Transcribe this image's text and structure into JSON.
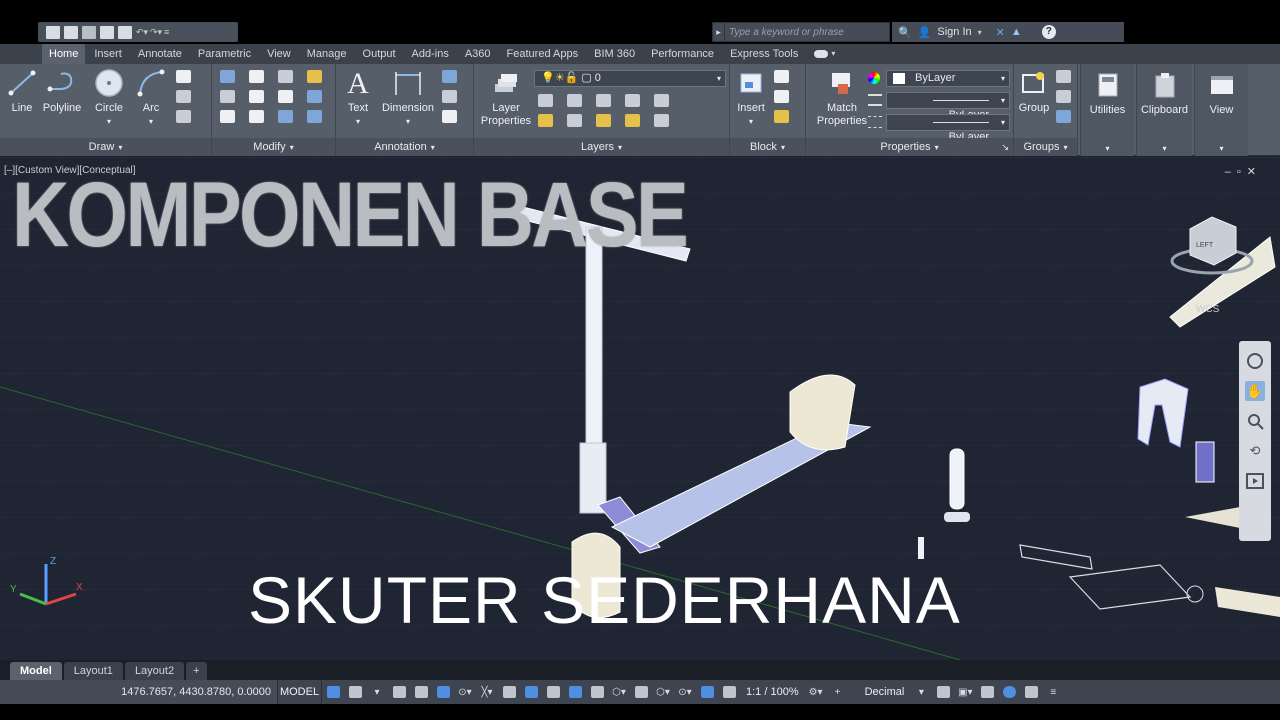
{
  "app": {
    "qat_icons": [
      "new-icon",
      "open-icon",
      "save-icon",
      "saveas-icon",
      "print-icon",
      "undo-icon",
      "redo-icon",
      "customize-icon"
    ],
    "search_placeholder": "Type a keyword or phrase",
    "sign_in": "Sign In",
    "help": "?"
  },
  "ribbon_tabs": [
    "Home",
    "Insert",
    "Annotate",
    "Parametric",
    "View",
    "Manage",
    "Output",
    "Add-ins",
    "A360",
    "Featured Apps",
    "BIM 360",
    "Performance",
    "Express Tools"
  ],
  "ribbon": {
    "draw": {
      "title": "Draw",
      "line": "Line",
      "polyline": "Polyline",
      "circle": "Circle",
      "arc": "Arc"
    },
    "modify": {
      "title": "Modify"
    },
    "annotation": {
      "title": "Annotation",
      "text": "Text",
      "dimension": "Dimension"
    },
    "layers": {
      "title": "Layers",
      "layer_properties_1": "Layer",
      "layer_properties_2": "Properties",
      "current_layer": "0"
    },
    "block": {
      "title": "Block",
      "insert": "Insert"
    },
    "properties": {
      "title": "Properties",
      "match_1": "Match",
      "match_2": "Properties",
      "color": "ByLayer",
      "linetype": "ByLayer",
      "lineweight": "ByLayer"
    },
    "groups": {
      "title": "Groups",
      "group": "Group"
    },
    "utilities": "Utilities",
    "clipboard": "Clipboard",
    "view": "View"
  },
  "viewport": {
    "label": "[–][Custom View][Conceptual]",
    "title_overlay": "KOMPONEN BASE",
    "subtitle_overlay": "SKUTER SEDERHANA",
    "viewcube_left": "LEFT",
    "viewcube_wcs": "WCS"
  },
  "layout_tabs": [
    "Model",
    "Layout1",
    "Layout2",
    "+"
  ],
  "status": {
    "coords": "1476.7657, 4430.8780, 0.0000",
    "model": "MODEL",
    "scale": "1:1 / 100%",
    "units": "Decimal"
  },
  "colors": {
    "accent": "#4f8ee0",
    "canvas": "#1f2533",
    "ribbon": "#565e6a"
  }
}
